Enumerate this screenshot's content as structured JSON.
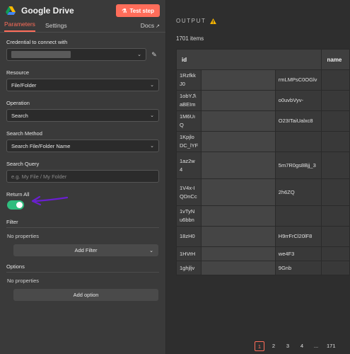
{
  "header": {
    "title": "Google Drive",
    "test_label": "Test step"
  },
  "tabs": [
    {
      "label": "Parameters"
    },
    {
      "label": "Settings"
    }
  ],
  "docs_label": "Docs",
  "fields": {
    "credential": {
      "label": "Credential to connect with"
    },
    "resource": {
      "label": "Resource",
      "value": "File/Folder"
    },
    "operation": {
      "label": "Operation",
      "value": "Search"
    },
    "search_method": {
      "label": "Search Method",
      "value": "Search File/Folder Name"
    },
    "search_query": {
      "label": "Search Query",
      "placeholder": "e.g. My File / My Folder"
    },
    "return_all": {
      "label": "Return All",
      "on": true
    }
  },
  "filter": {
    "title": "Filter",
    "no_props": "No properties",
    "button": "Add Filter"
  },
  "options": {
    "title": "Options",
    "no_props": "No properties",
    "button": "Add option"
  },
  "output": {
    "title": "OUTPUT",
    "count": "1701 items",
    "columns": [
      "id",
      "name"
    ],
    "rows": [
      {
        "a": "1Rzfkk",
        "b": "J0",
        "c": "rmLMPsC0OGlv"
      },
      {
        "a": "1obYJ\\",
        "b": "aBEIm",
        "c": "o0uvbVyv-"
      },
      {
        "a": "1M6Uı",
        "b": "Q",
        "c": "O23ITaiUalxc8"
      },
      {
        "a": "1Kpjlo",
        "b": "DC_lYF",
        "c": ""
      },
      {
        "a": "1az2w",
        "b": "4",
        "c": "5m7R0gs8Bjj_3"
      },
      {
        "a": "1V4x-I",
        "b": "QDnCc",
        "c": "2h6ZQ"
      },
      {
        "a": "1vTyN",
        "b": "u6bbn",
        "c": ""
      },
      {
        "a": "18zH0",
        "b": "",
        "c": "H9rrFrCl20lF8"
      },
      {
        "a": "1HVrH",
        "b": "",
        "c": "we4F3"
      },
      {
        "a": "1ghjljv",
        "b": "",
        "c": "9Gnb"
      }
    ]
  },
  "pagination": {
    "pages": [
      "1",
      "2",
      "3",
      "4",
      "...",
      "171"
    ],
    "current": "1"
  },
  "colors": {
    "accent": "#ff6d5a",
    "toggle_on": "#2fbd7e",
    "arrow": "#6a1fd0"
  }
}
